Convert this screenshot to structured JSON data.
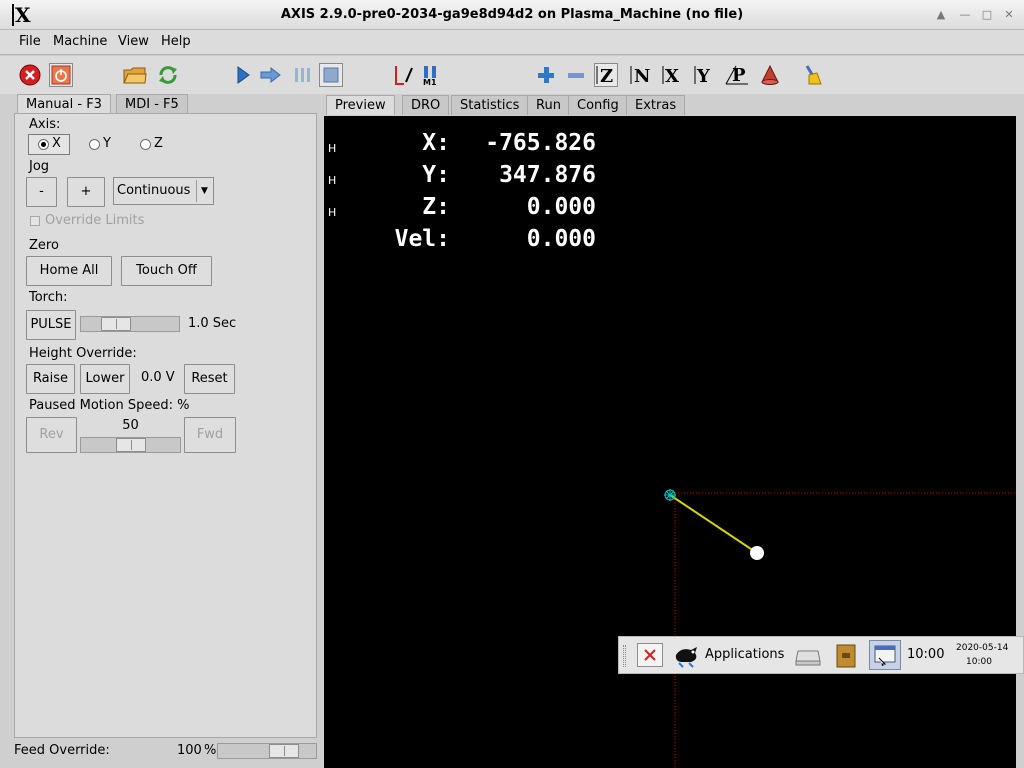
{
  "window": {
    "title": "AXIS 2.9.0-pre0-2034-ga9e8d94d2 on Plasma_Machine (no file)",
    "logo_text": "X"
  },
  "menu": [
    "File",
    "Machine",
    "View",
    "Help"
  ],
  "left_tabs": [
    {
      "label": "Manual - F3",
      "active": true
    },
    {
      "label": "MDI - F5",
      "active": false
    }
  ],
  "manual": {
    "axis_label": "Axis:",
    "axes": [
      {
        "label": "X",
        "selected": true
      },
      {
        "label": "Y",
        "selected": false
      },
      {
        "label": "Z",
        "selected": false
      }
    ],
    "jog_label": "Jog",
    "jog_minus": "-",
    "jog_plus": "+",
    "jog_mode": "Continuous",
    "override_limits": "Override Limits",
    "zero_label": "Zero",
    "home_all": "Home All",
    "touch_off": "Touch Off",
    "torch_label": "Torch:",
    "pulse": "PULSE",
    "pulse_time": "1.0 Sec",
    "pulse_slider_fraction": 0.3,
    "height_label": "Height Override:",
    "raise": "Raise",
    "lower": "Lower",
    "height_value": "0.0 V",
    "reset": "Reset",
    "paused_label": "Paused Motion Speed: %",
    "rev": "Rev",
    "fwd": "Fwd",
    "paused_value": "50",
    "paused_fraction": 0.5
  },
  "right_tabs": [
    {
      "label": "Preview",
      "active": true
    },
    {
      "label": "DRO",
      "active": false
    },
    {
      "label": "Statistics",
      "active": false
    },
    {
      "label": "Run",
      "active": false
    },
    {
      "label": "Config",
      "active": false
    },
    {
      "label": "Extras",
      "active": false
    }
  ],
  "dro": [
    {
      "flag": "H",
      "label": "X:",
      "value": "-765.826"
    },
    {
      "flag": "H",
      "label": "Y:",
      "value": "347.876"
    },
    {
      "flag": "H",
      "label": "Z:",
      "value": "0.000"
    },
    {
      "flag": "",
      "label": "Vel:",
      "value": "0.000"
    }
  ],
  "feed_override": {
    "label": "Feed Override:",
    "value": "100",
    "unit": "%",
    "fraction": 0.75
  },
  "taskbar": {
    "applications": "Applications",
    "clock": "10:00",
    "date": "2020-05-14",
    "time_small": "10:00"
  },
  "colors": {
    "preview_bg": "#000000",
    "toolpath": "#d4d400",
    "origin": "#00c8c8",
    "limits": "#c80000"
  }
}
